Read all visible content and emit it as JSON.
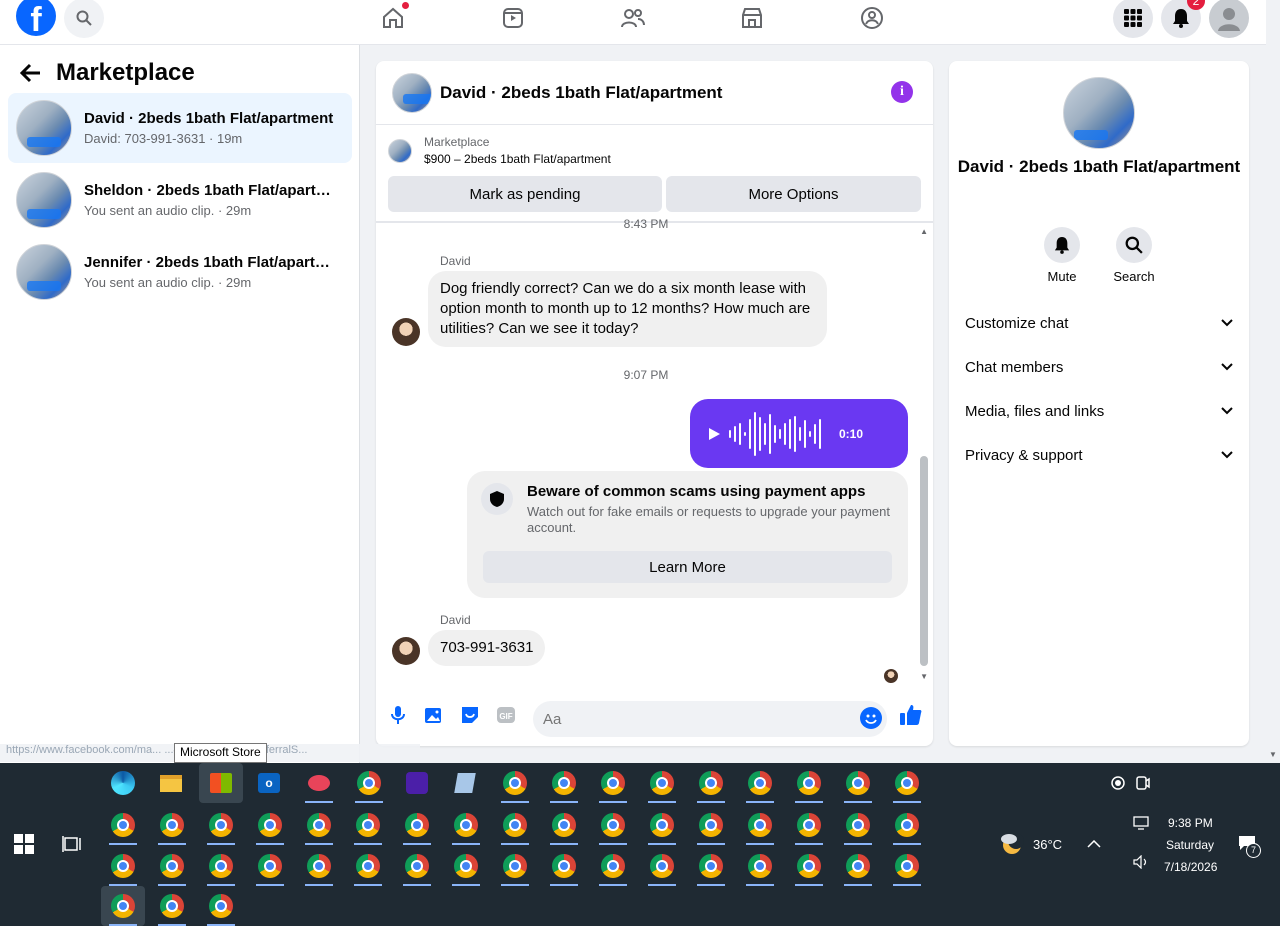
{
  "colors": {
    "fb_blue": "#0866ff",
    "audio_bubble": "#6a38f2",
    "info": "#9333ea",
    "notification": "#e41e3f",
    "active_row": "#ebf5ff"
  },
  "topnav": {
    "logo": "f",
    "icons": [
      "home-icon",
      "video-icon",
      "friends-icon",
      "marketplace-icon",
      "groups-icon"
    ],
    "notification_count": "2"
  },
  "sidebar": {
    "title": "Marketplace",
    "conversations": [
      {
        "name": "David · 2beds 1bath Flat/apartment",
        "subtitle": "David: 703-991-3631 · 19m"
      },
      {
        "name": "Sheldon · 2beds 1bath Flat/apartm...",
        "subtitle": "You sent an audio clip. · 29m"
      },
      {
        "name": "Jennifer · 2beds 1bath Flat/apartm...",
        "subtitle": "You sent an audio clip. · 29m"
      }
    ]
  },
  "chat": {
    "title": "David · 2beds 1bath Flat/apartment",
    "listing_label": "Marketplace",
    "listing_price": "$900 – 2beds 1bath Flat/apartment",
    "mark_pending": "Mark as pending",
    "more_options": "More Options",
    "time_top": "8:43 PM",
    "msg1_sender": "David",
    "msg1_text": "Dog friendly correct?  Can we do a six month lease with option month to month up to 12 months?  How much are utilities? Can we see it today?",
    "time_mid": "9:07 PM",
    "audio_duration": "0:10",
    "scam_title": "Beware of common scams using payment apps",
    "scam_desc": "Watch out for fake emails or requests to upgrade your payment account.",
    "learn_more": "Learn More",
    "msg2_sender": "David",
    "msg2_text": "703-991-3631",
    "input_placeholder": "Aa"
  },
  "rpanel": {
    "title": "David · 2beds 1bath Flat/apartment",
    "mute": "Mute",
    "search": "Search",
    "sections": [
      "Customize chat",
      "Chat members",
      "Media, files and links",
      "Privacy & support"
    ]
  },
  "statusbar": {
    "url": "https://www.facebook.com/ma...                              ...477447958372/?referralS...",
    "tooltip": "Microsoft Store"
  },
  "taskbar": {
    "temperature": "36°C",
    "time": "9:38 PM",
    "day": "Saturday",
    "date": "7/18/2026",
    "notifications": "7"
  }
}
